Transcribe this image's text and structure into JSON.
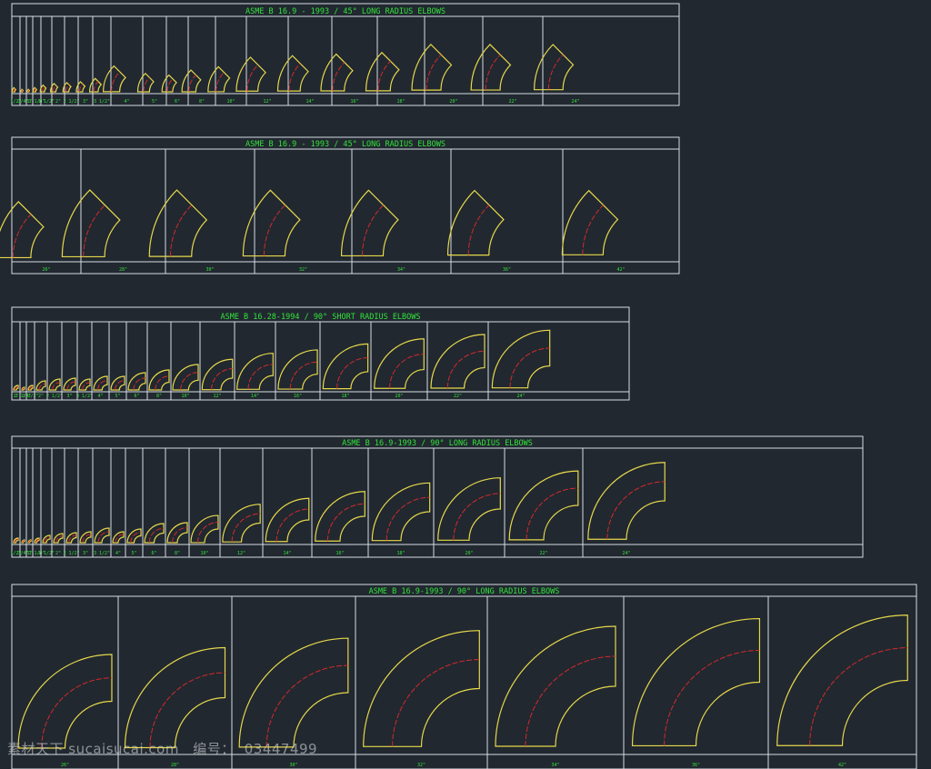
{
  "colors": {
    "background": "#212830",
    "frame": "#d8dde2",
    "title": "#33e33a",
    "outline": "#e6d84a",
    "centerline": "#d42a2a",
    "label": "#33e33a"
  },
  "tables": [
    {
      "title": "ASME B 16.9 - 1993 / 45° LONG RADIUS ELBOWS",
      "elbow_angle_deg": 45,
      "sizes": [
        "1/2\"",
        "3/4\"",
        "1\"",
        "1 1/4\"",
        "1 1/2\"",
        "2\"",
        "2 1/2\"",
        "3\"",
        "3 1/2\"",
        "4\"",
        "5\"",
        "6\"",
        "8\"",
        "10\"",
        "12\"",
        "14\"",
        "16\"",
        "18\"",
        "20\"",
        "22\"",
        "24\""
      ]
    },
    {
      "title": "ASME B 16.9 - 1993 / 45° LONG RADIUS ELBOWS",
      "elbow_angle_deg": 45,
      "sizes": [
        "26\"",
        "28\"",
        "30\"",
        "32\"",
        "34\"",
        "36\"",
        "42\""
      ]
    },
    {
      "title": "ASME B 16.28-1994 / 90° SHORT RADIUS ELBOWS",
      "elbow_angle_deg": 90,
      "sizes": [
        "1\"",
        "1 1/4\"",
        "1 1/2\"",
        "2\"",
        "2 1/2\"",
        "3\"",
        "3 1/2\"",
        "4\"",
        "5\"",
        "6\"",
        "8\"",
        "10\"",
        "12\"",
        "14\"",
        "16\"",
        "18\"",
        "20\"",
        "22\"",
        "24\""
      ]
    },
    {
      "title": "ASME B 16.9-1993 / 90° LONG RADIUS ELBOWS",
      "elbow_angle_deg": 90,
      "sizes": [
        "1/2\"",
        "3/4\"",
        "1\"",
        "1 1/4\"",
        "1 1/2\"",
        "2\"",
        "2 1/2\"",
        "3\"",
        "3 1/2\"",
        "4\"",
        "5\"",
        "6\"",
        "8\"",
        "10\"",
        "12\"",
        "14\"",
        "16\"",
        "18\"",
        "20\"",
        "22\"",
        "24\""
      ]
    },
    {
      "title": "ASME B 16.9-1993 / 90° LONG RADIUS ELBOWS",
      "elbow_angle_deg": 90,
      "sizes": [
        "26\"",
        "28\"",
        "30\"",
        "32\"",
        "34\"",
        "36\"",
        "42\""
      ]
    }
  ],
  "watermark": {
    "site": "素材天下 sucaisucai.com",
    "id_label": "编号：",
    "id_value": "03447499"
  }
}
